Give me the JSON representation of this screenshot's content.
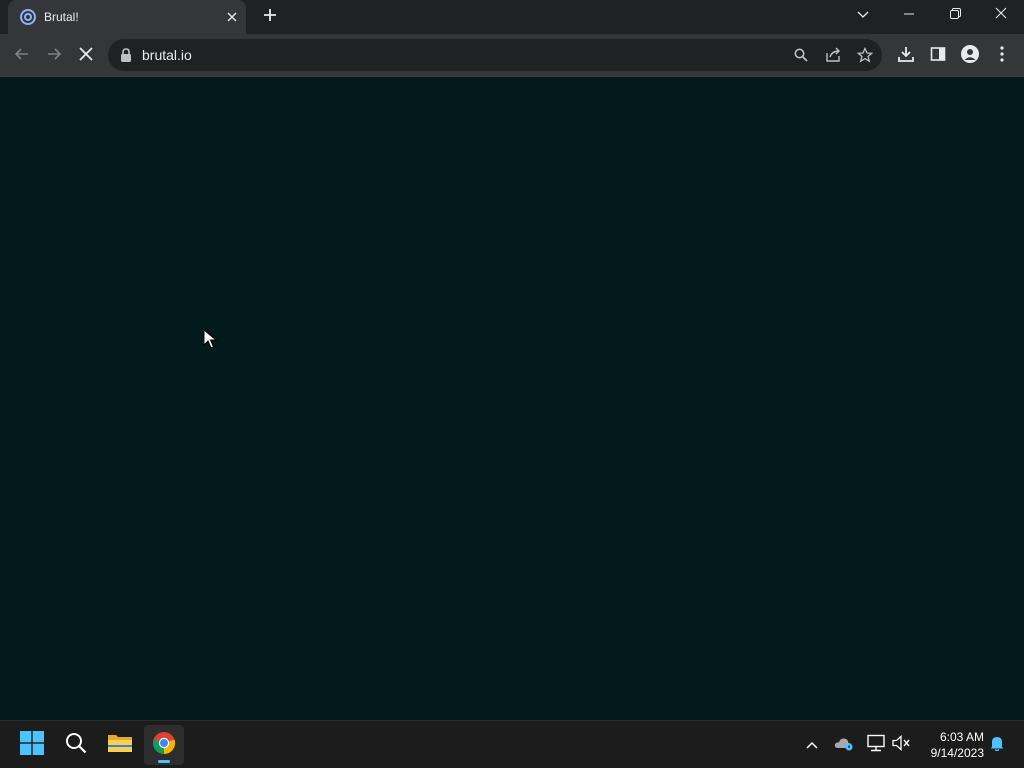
{
  "browser": {
    "tab": {
      "title": "Brutal!"
    },
    "address_bar": {
      "url": "brutal.io"
    }
  },
  "taskbar": {
    "clock": {
      "time": "6:03 AM",
      "date": "9/14/2023"
    }
  },
  "colors": {
    "page_background": "#021a1c",
    "browser_chrome": "#35363a",
    "tab_strip": "#202124",
    "taskbar": "#1c1c1c",
    "accent": "#4cc2ff"
  },
  "icons": {
    "tab": [
      "favicon-icon",
      "close-icon",
      "plus-icon"
    ],
    "window": [
      "chevron-down-icon",
      "minimize-icon",
      "restore-icon",
      "close-icon"
    ],
    "toolbar": [
      "back-arrow-icon",
      "forward-arrow-icon",
      "stop-icon",
      "lock-icon",
      "search-icon",
      "share-icon",
      "star-icon",
      "download-icon",
      "side-panel-icon",
      "profile-icon",
      "kebab-menu-icon"
    ],
    "taskbar": [
      "windows-start-icon",
      "search-icon",
      "file-explorer-icon",
      "chrome-icon",
      "chevron-up-icon",
      "onedrive-icon",
      "network-icon",
      "volume-muted-icon",
      "bell-icon"
    ]
  }
}
